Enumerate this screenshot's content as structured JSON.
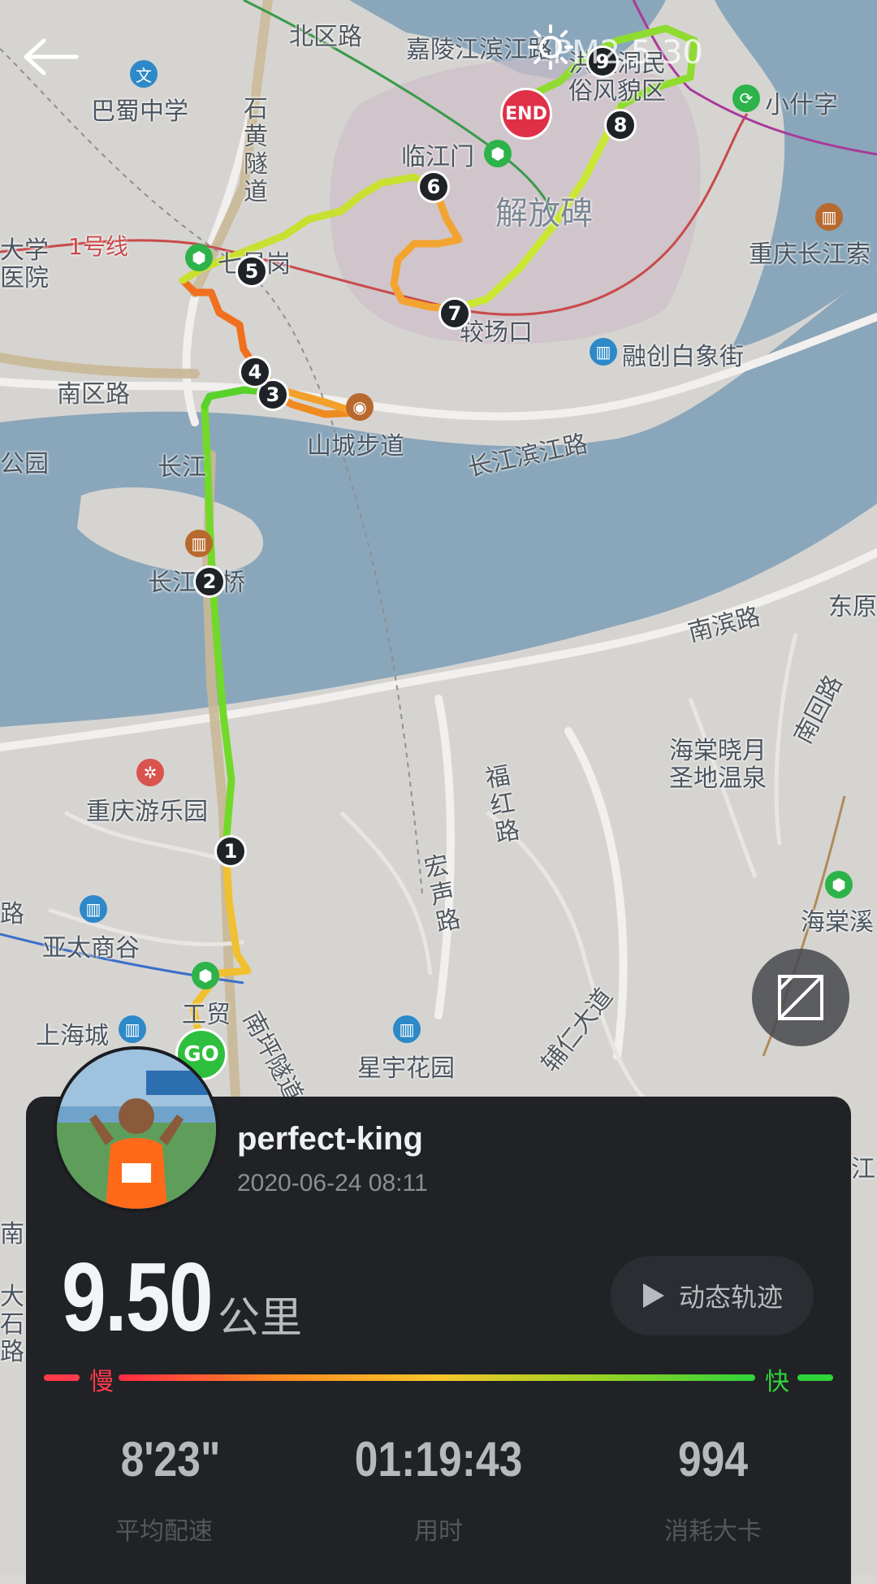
{
  "header": {
    "aqi": "PM2.5 30"
  },
  "map": {
    "labels": {
      "beiqu": "北区路",
      "jialing": "嘉陵江滨江路",
      "bashu": "巴蜀中学",
      "shihuang": "石黄隧道",
      "linjiang": "临江门",
      "jiefang": "解放碑",
      "hongya": "洪崖洞民俗风貌区",
      "xiaoshizi": "小什字",
      "daxue": "大学医院",
      "line1": "1号线",
      "qixing": "七星岗",
      "jiaochang": "较场口",
      "rongchuang": "融创白象街",
      "changjiangsuo": "重庆长江索",
      "nanqu": "南区路",
      "shancheng": "山城步道",
      "changjiangbin": "长江滨江路",
      "gongyuan": "公园",
      "changjiang": "长江",
      "daqiao": "长江大桥",
      "nanbin": "南滨路",
      "dongyuan": "东原",
      "nansi": "南回路",
      "haitang": "海棠晓月圣地温泉",
      "fuhong": "福红路",
      "youle": "重庆游乐园",
      "hongsheng": "宏声路",
      "yatai": "亚太商谷",
      "haitangxi": "海棠溪",
      "gongmao": "工贸",
      "shanghai": "上海城",
      "nanping": "南坪隧道",
      "xingyu": "星宇花园",
      "furen": "辅仁大道",
      "lu": "路",
      "nan": "南",
      "da": "大石路",
      "jiang": "江"
    },
    "end_label": "END",
    "go_label": "GO",
    "km_markers": [
      "1",
      "2",
      "3",
      "4",
      "5",
      "6",
      "7",
      "8",
      "9"
    ]
  },
  "profile": {
    "username": "perfect-king",
    "datetime": "2020-06-24 08:11"
  },
  "summary": {
    "distance": "9.50",
    "unit": "公里",
    "track_button": "动态轨迹",
    "slow": "慢",
    "fast": "快"
  },
  "stats": [
    {
      "value": "8'23\"",
      "label": "平均配速"
    },
    {
      "value": "01:19:43",
      "label": "用时"
    },
    {
      "value": "994",
      "label": "消耗大卡"
    }
  ],
  "colors": {
    "slow": "#ff3a4a",
    "fast": "#2fd33a",
    "card": "#212226"
  }
}
